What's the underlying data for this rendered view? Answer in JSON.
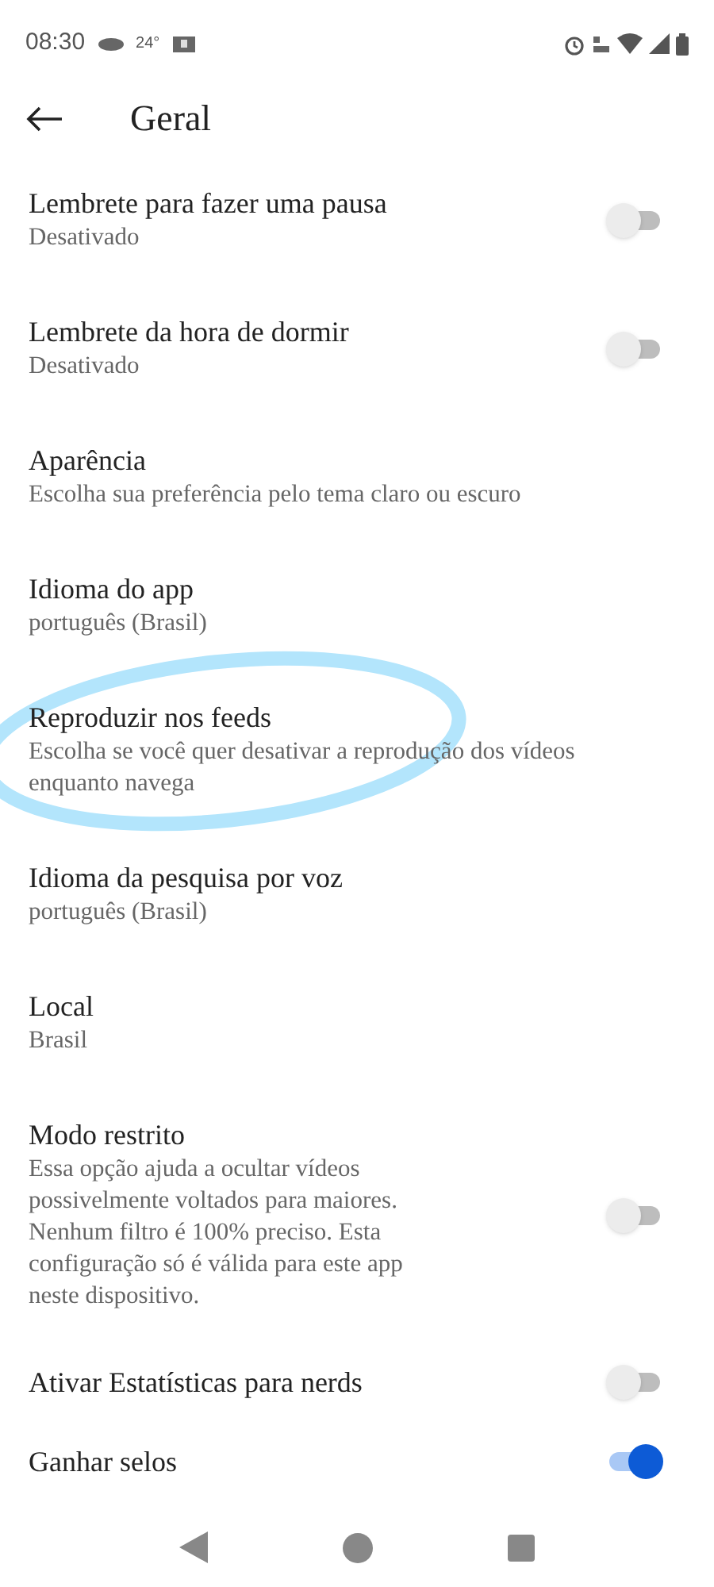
{
  "status_bar": {
    "time": "08:30",
    "temperature": "24°"
  },
  "header": {
    "title": "Geral"
  },
  "settings": [
    {
      "kind": "switch",
      "title": "Lembrete para fazer uma pausa",
      "subtitle": "Desativado",
      "on": false
    },
    {
      "kind": "switch",
      "title": "Lembrete da hora de dormir",
      "subtitle": "Desativado",
      "on": false
    },
    {
      "kind": "text",
      "title": "Aparência",
      "subtitle": "Escolha sua preferência pelo tema claro ou escuro"
    },
    {
      "kind": "text",
      "title": "Idioma do app",
      "subtitle": "português (Brasil)"
    },
    {
      "kind": "text",
      "title": "Reproduzir nos feeds",
      "subtitle": "Escolha se você quer desativar a reprodução dos vídeos enquanto navega"
    },
    {
      "kind": "text",
      "title": "Idioma da pesquisa por voz",
      "subtitle": "português (Brasil)"
    },
    {
      "kind": "text",
      "title": "Local",
      "subtitle": "Brasil"
    },
    {
      "kind": "switch",
      "title": "Modo restrito",
      "subtitle": "Essa opção ajuda a ocultar vídeos possivelmente voltados para maiores. Nenhum filtro é 100% preciso. Esta configuração só é válida para este app neste dispositivo.",
      "on": false
    },
    {
      "kind": "switch",
      "title": "Ativar Estatísticas para nerds",
      "on": false
    },
    {
      "kind": "switch",
      "title": "Ganhar selos",
      "on": true
    }
  ]
}
